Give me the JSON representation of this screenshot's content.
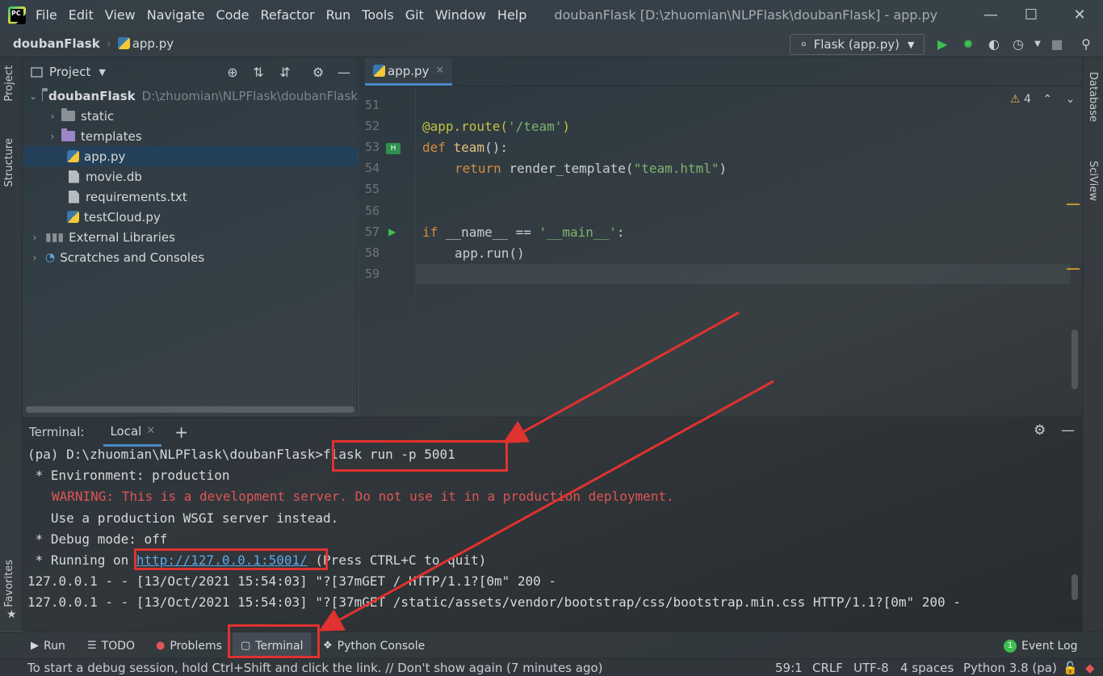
{
  "menu": {
    "items": [
      "File",
      "Edit",
      "View",
      "Navigate",
      "Code",
      "Refactor",
      "Run",
      "Tools",
      "Git",
      "Window",
      "Help"
    ],
    "window_title": "doubanFlask [D:\\zhuomian\\NLPFlask\\doubanFlask] - app.py",
    "logo_text": "PC"
  },
  "navbar": {
    "project": "doubanFlask",
    "file": "app.py",
    "run_config": "Flask (app.py)"
  },
  "left_strip": {
    "project_tab": "Project",
    "structure_tab": "Structure",
    "favorites_tab": "Favorites"
  },
  "right_strip": {
    "database_tab": "Database",
    "sciview_tab": "SciView"
  },
  "project_panel": {
    "title": "Project",
    "root": {
      "name": "doubanFlask",
      "path": "D:\\zhuomian\\NLPFlask\\doubanFlask"
    },
    "items": [
      {
        "label": "static"
      },
      {
        "label": "templates"
      },
      {
        "label": "app.py"
      },
      {
        "label": "movie.db"
      },
      {
        "label": "requirements.txt"
      },
      {
        "label": "testCloud.py"
      },
      {
        "label": "External Libraries"
      },
      {
        "label": "Scratches and Consoles"
      }
    ]
  },
  "editor": {
    "tab": "app.py",
    "warning_count": "4",
    "line_numbers": [
      "51",
      "52",
      "53",
      "54",
      "55",
      "56",
      "57",
      "58",
      "59"
    ],
    "code": {
      "l52_deco": "@app.route(",
      "l52_str": "'/team'",
      "l52_end": ")",
      "l53_kw": "def ",
      "l53_fn": "team",
      "l53_end": "():",
      "l54_kw": "return ",
      "l54_call": "render_template(",
      "l54_str": "\"team.html\"",
      "l54_end": ")",
      "l57_kw": "if ",
      "l57_mid": "__name__ == ",
      "l57_str": "'__main__'",
      "l57_end": ":",
      "l58": "app.run()"
    }
  },
  "terminal": {
    "label": "Terminal:",
    "tab": "Local",
    "lines": {
      "prompt": "(pa) D:\\zhuomian\\NLPFlask\\doubanFlask>",
      "command": "flask run -p 5001",
      "env": " * Environment: production",
      "warning": "WARNING: This is a development server. Do not use it in a production deployment.",
      "wsgi": "   Use a production WSGI server instead.",
      "debug": " * Debug mode: off",
      "running_prefix": " * Running on ",
      "url": "http://127.0.0.1:5001/",
      "running_suffix": " (Press CTRL+C to quit)",
      "log1": "127.0.0.1 - - [13/Oct/2021 15:54:03] \"?[37mGET / HTTP/1.1?[0m\" 200 -",
      "log2": "127.0.0.1 - - [13/Oct/2021 15:54:03] \"?[37mGET /static/assets/vendor/bootstrap/css/bootstrap.min.css HTTP/1.1?[0m\" 200 -"
    }
  },
  "tool_tabs": {
    "run": "Run",
    "todo": "TODO",
    "problems": "Problems",
    "terminal": "Terminal",
    "python_console": "Python Console",
    "event_log": "Event Log",
    "event_log_count": "1"
  },
  "statusbar": {
    "message": "To start a debug session, hold Ctrl+Shift and click the link. // Don't show again (7 minutes ago)",
    "position": "59:1",
    "line_sep": "CRLF",
    "encoding": "UTF-8",
    "indent": "4 spaces",
    "interpreter": "Python 3.8 (pa)"
  },
  "colors": {
    "annotation": "#e0322f",
    "accent": "#4a88c7",
    "run_green": "#3fbf4f",
    "warning_red": "#e05555"
  }
}
